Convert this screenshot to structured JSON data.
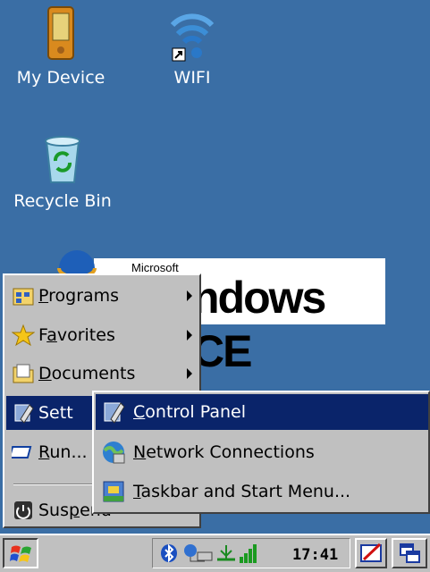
{
  "desktop": {
    "icons": [
      {
        "label": "My Device"
      },
      {
        "label": "WIFI"
      },
      {
        "label": "Recycle Bin"
      }
    ],
    "banner": {
      "brand_small": "Microsoft",
      "brand_text": "ndows CE"
    }
  },
  "start_menu": {
    "items": [
      {
        "label": "Programs",
        "accel": "P",
        "rest": "rograms"
      },
      {
        "label": "Favorites",
        "accel": "a",
        "pre": "F",
        "rest": "vorites"
      },
      {
        "label": "Documents",
        "accel": "D",
        "rest": "ocuments"
      },
      {
        "label": "Sett"
      },
      {
        "label": "Run...",
        "accel": "R",
        "rest": "un..."
      },
      {
        "label": "Suspend",
        "pre": "Sus",
        "accel": "p",
        "rest": "end"
      }
    ]
  },
  "settings_submenu": {
    "items": [
      {
        "accel": "C",
        "rest": "ontrol Panel"
      },
      {
        "accel": "N",
        "rest": "etwork Connections"
      },
      {
        "accel": "T",
        "rest": "askbar and Start Menu..."
      }
    ]
  },
  "taskbar": {
    "clock": "17:41",
    "icons": [
      "start-flag-icon",
      "bluetooth-icon",
      "network-icon",
      "usb-icon",
      "signal-icon",
      "input-panel-icon",
      "switch-windows-icon"
    ]
  }
}
